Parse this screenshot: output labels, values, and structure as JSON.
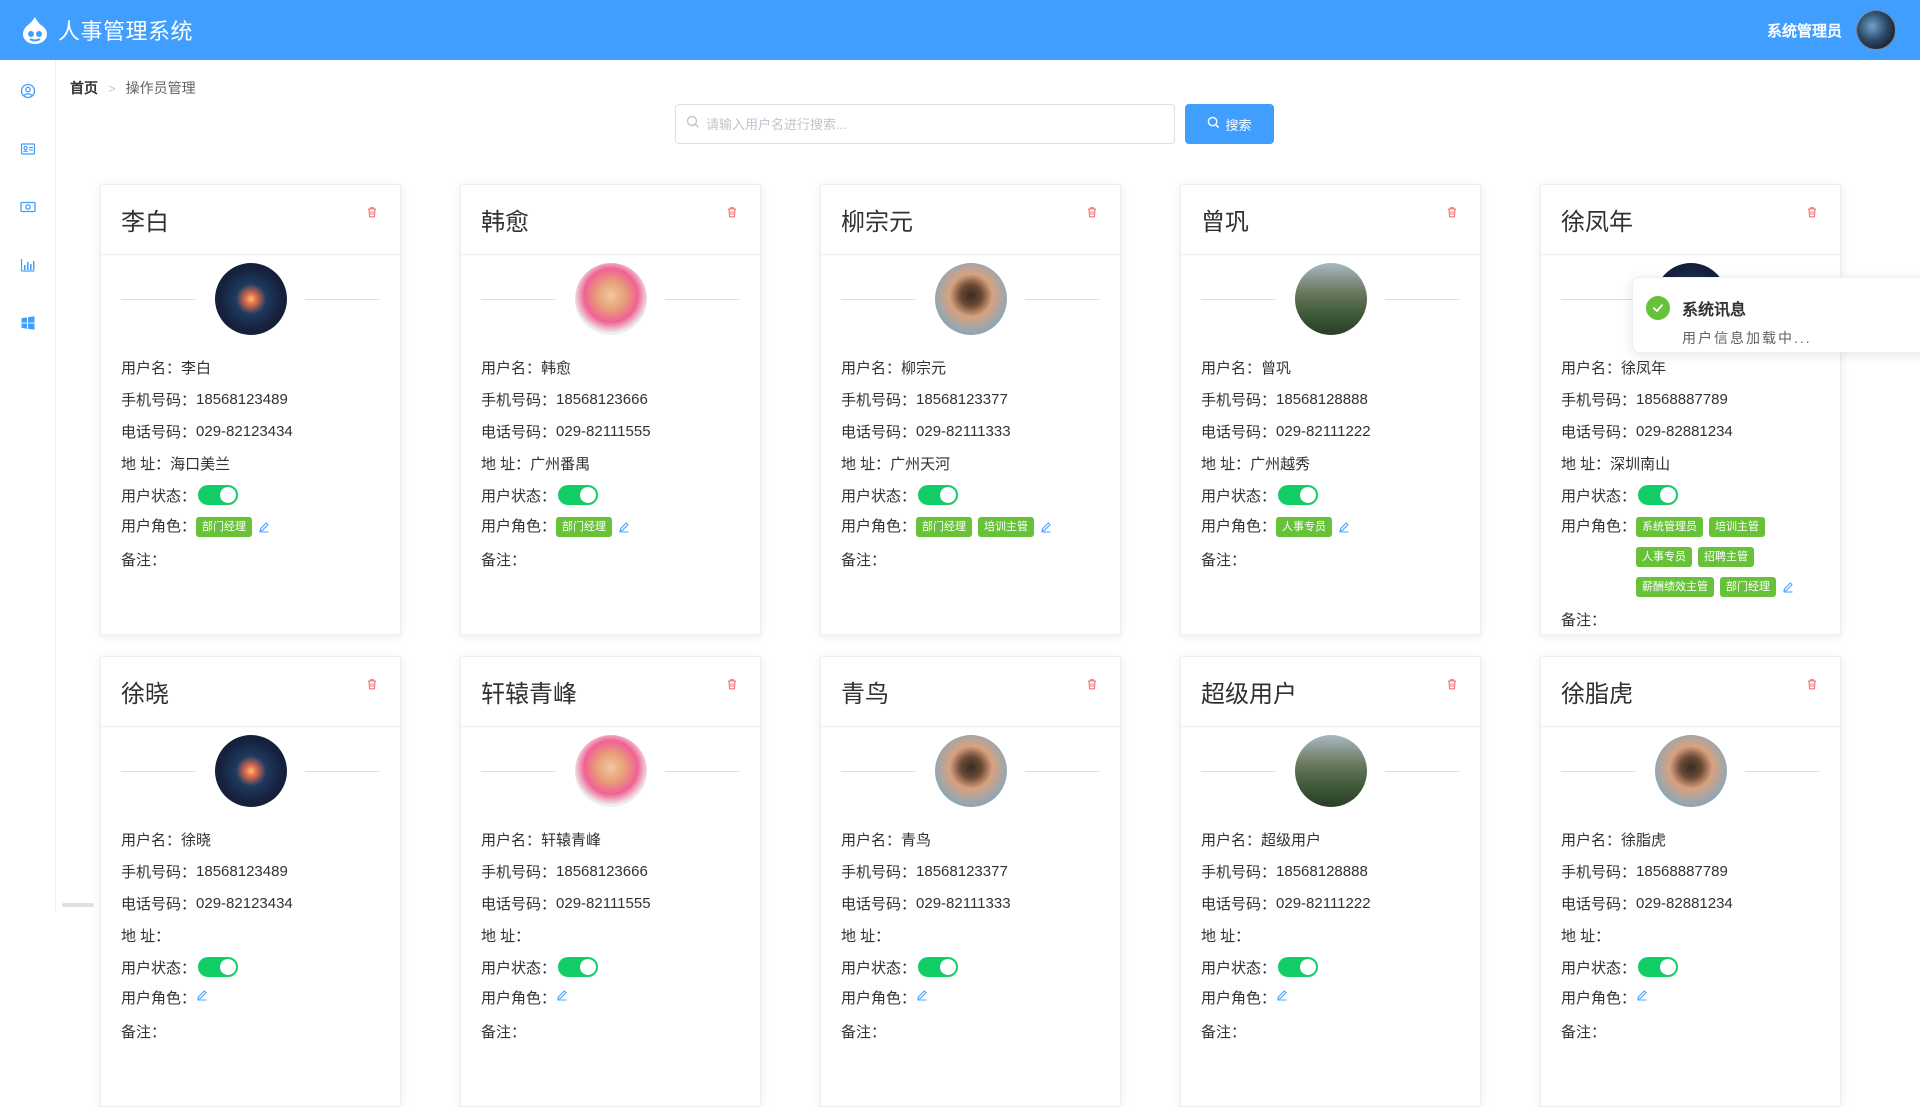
{
  "header": {
    "title": "人事管理系统",
    "user_name": "系统管理员"
  },
  "sidebar": {
    "items": [
      {
        "icon": "user-circle-icon"
      },
      {
        "icon": "id-card-icon"
      },
      {
        "icon": "money-icon"
      },
      {
        "icon": "bar-chart-icon"
      },
      {
        "icon": "windows-icon"
      }
    ]
  },
  "breadcrumb": {
    "home": "首页",
    "current": "操作员管理"
  },
  "search": {
    "placeholder": "请输入用户名进行搜索...",
    "button_label": "搜索"
  },
  "labels": {
    "username": "用户名：",
    "mobile": "手机号码：",
    "phone": "电话号码：",
    "address": "地 址：",
    "status": "用户状态：",
    "roles": "用户角色：",
    "remark": "备注："
  },
  "cards": [
    {
      "name": "李白",
      "username": "李白",
      "mobile": "18568123489",
      "phone": "029-82123434",
      "address": "海口美兰",
      "status_on": true,
      "roles": [
        "部门经理"
      ],
      "remark": "",
      "avatar": "city"
    },
    {
      "name": "韩愈",
      "username": "韩愈",
      "mobile": "18568123666",
      "phone": "029-82111555",
      "address": "广州番禺",
      "status_on": true,
      "roles": [
        "部门经理"
      ],
      "remark": "",
      "avatar": "girls"
    },
    {
      "name": "柳宗元",
      "username": "柳宗元",
      "mobile": "18568123377",
      "phone": "029-82111333",
      "address": "广州天河",
      "status_on": true,
      "roles": [
        "部门经理",
        "培训主管"
      ],
      "remark": "",
      "avatar": "woman"
    },
    {
      "name": "曾巩",
      "username": "曾巩",
      "mobile": "18568128888",
      "phone": "029-82111222",
      "address": "广州越秀",
      "status_on": true,
      "roles": [
        "人事专员"
      ],
      "remark": "",
      "avatar": "mountain"
    },
    {
      "name": "徐凤年",
      "username": "徐凤年",
      "mobile": "18568887789",
      "phone": "029-82881234",
      "address": "深圳南山",
      "status_on": true,
      "roles": [
        "系统管理员",
        "培训主管",
        "人事专员",
        "招聘主管",
        "薪酬绩效主管",
        "部门经理"
      ],
      "remark": "",
      "avatar": "city"
    },
    {
      "name": "徐晓",
      "username": "徐晓",
      "mobile": "18568123489",
      "phone": "029-82123434",
      "address": "",
      "status_on": true,
      "roles": [],
      "remark": "",
      "avatar": "city"
    },
    {
      "name": "轩辕青峰",
      "username": "轩辕青峰",
      "mobile": "18568123666",
      "phone": "029-82111555",
      "address": "",
      "status_on": true,
      "roles": [],
      "remark": "",
      "avatar": "girls"
    },
    {
      "name": "青鸟",
      "username": "青鸟",
      "mobile": "18568123377",
      "phone": "029-82111333",
      "address": "",
      "status_on": true,
      "roles": [],
      "remark": "",
      "avatar": "woman"
    },
    {
      "name": "超级用户",
      "username": "超级用户",
      "mobile": "18568128888",
      "phone": "029-82111222",
      "address": "",
      "status_on": true,
      "roles": [],
      "remark": "",
      "avatar": "mountain"
    },
    {
      "name": "徐脂虎",
      "username": "徐脂虎",
      "mobile": "18568887789",
      "phone": "029-82881234",
      "address": "",
      "status_on": true,
      "roles": [],
      "remark": "",
      "avatar": "woman"
    }
  ],
  "notification": {
    "title": "系统讯息",
    "message": "用户信息加载中..."
  },
  "colors": {
    "primary": "#409eff",
    "success": "#67c23a",
    "danger": "#f56c6c",
    "toggle_on": "#13ce66"
  }
}
